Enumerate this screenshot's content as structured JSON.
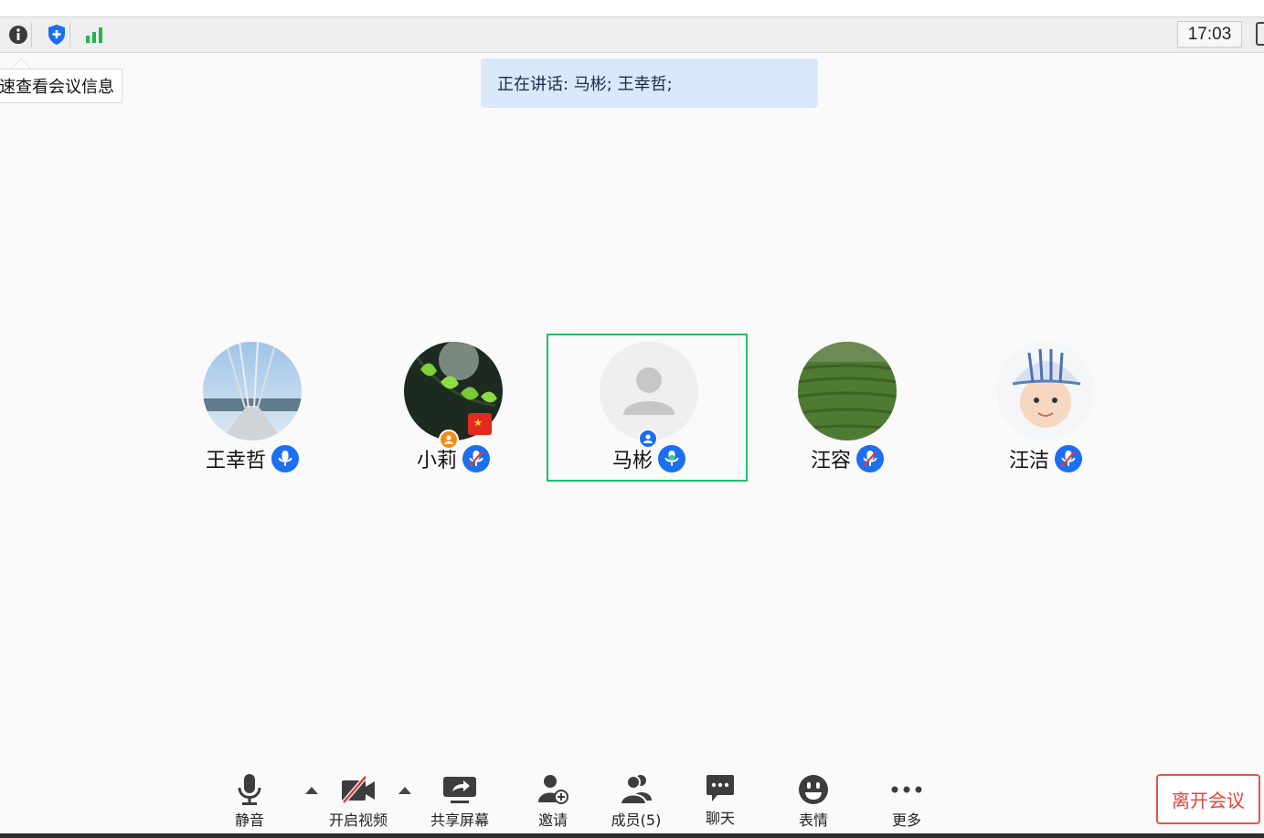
{
  "topbar": {
    "clock": "17:03",
    "icons": [
      "info-icon",
      "security-shield-icon",
      "signal-strength-icon"
    ],
    "colors": {
      "shield": "#1c6ef2",
      "signal": "#22b552"
    }
  },
  "tooltip": {
    "text": "速查看会议信息"
  },
  "speaking_banner": {
    "text": "正在讲话: 马彬; 王幸哲;"
  },
  "participants": [
    {
      "name": "王幸哲",
      "mic": "on",
      "active": false
    },
    {
      "name": "小莉",
      "mic": "muted",
      "active": false,
      "host_badge": true,
      "flag_badge": true
    },
    {
      "name": "马彬",
      "mic": "speaking",
      "active": true,
      "cohost_badge": true
    },
    {
      "name": "汪容",
      "mic": "muted",
      "active": false
    },
    {
      "name": "汪洁",
      "mic": "muted",
      "active": false
    }
  ],
  "toolbar": {
    "mute_label": "静音",
    "video_label": "开启视频",
    "share_label": "共享屏幕",
    "invite_label": "邀请",
    "members_label": "成员(5)",
    "chat_label": "聊天",
    "reaction_label": "表情",
    "more_label": "更多",
    "leave_label": "离开会议"
  },
  "colors": {
    "active_border": "#1ec06a",
    "mic_badge": "#1c6ef2",
    "leave": "#e3443c",
    "banner_bg": "#d9e8fb"
  }
}
